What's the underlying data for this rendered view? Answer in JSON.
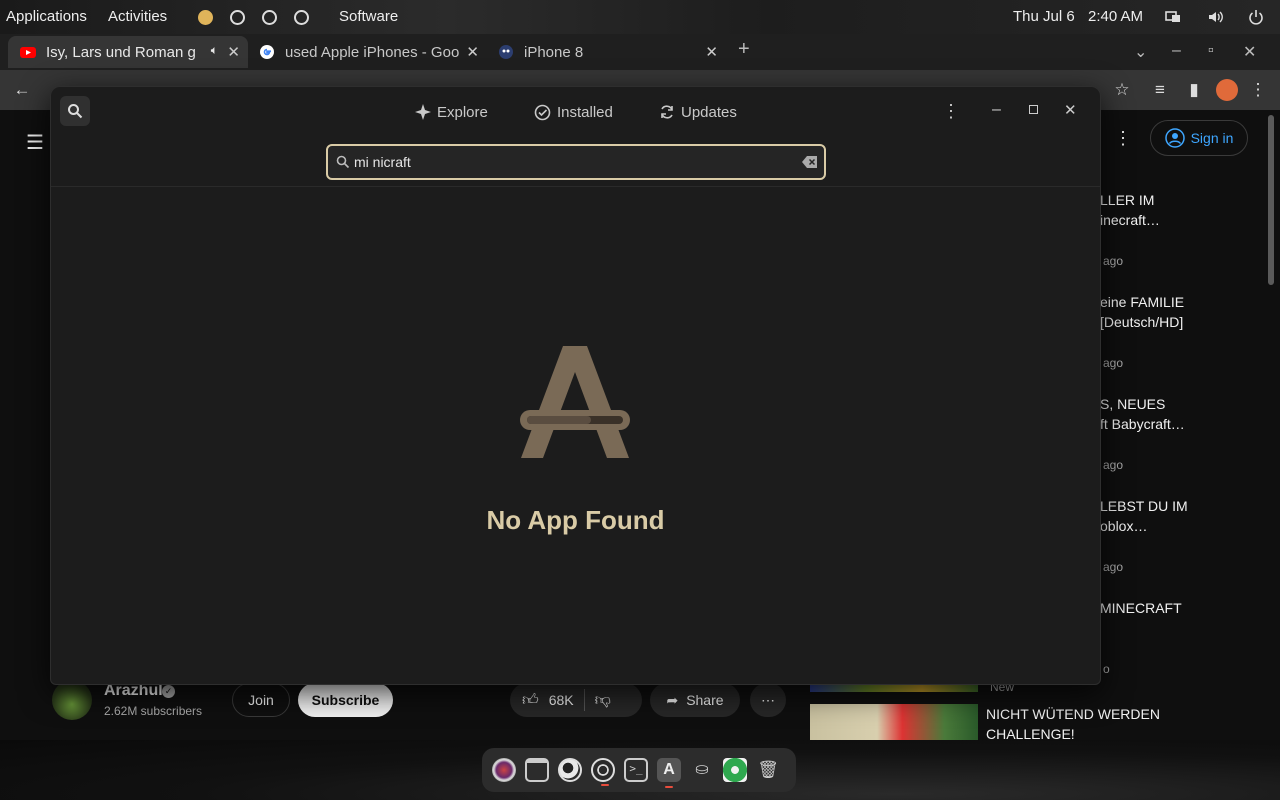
{
  "topbar": {
    "applications": "Applications",
    "activities": "Activities",
    "current_app": "Software",
    "date": "Thu Jul 6",
    "time": "2:40 AM"
  },
  "tabs": [
    {
      "title": "Isy, Lars und Roman g",
      "favicon": "youtube-icon",
      "audio": true
    },
    {
      "title": "used Apple iPhones - Goo",
      "favicon": "google-icon"
    },
    {
      "title": "iPhone 8",
      "favicon": "gsmarena-icon"
    }
  ],
  "youtube": {
    "sign_in": "Sign in",
    "channel_name": "Arazhul",
    "subscribers": "2.62M subscribers",
    "join": "Join",
    "subscribe": "Subscribe",
    "likes": "68K",
    "share": "Share",
    "recommendations": [
      {
        "title": "LLER IM\ninecraft…",
        "meta": "ago"
      },
      {
        "title": "eine FAMILIE\n[Deutsch/HD]",
        "meta": "ago"
      },
      {
        "title": "S, NEUES\nft Babycraft…",
        "meta": "ago"
      },
      {
        "title": "LEBST DU IM\noblox…",
        "meta": "ago"
      },
      {
        "title": "MINECRAFT",
        "meta": "o"
      },
      {
        "title": "NICHT WÜTEND WERDEN\nCHALLENGE!",
        "meta": "New"
      }
    ]
  },
  "app_center": {
    "tabs": [
      "Explore",
      "Installed",
      "Updates"
    ],
    "search_value": "mi nicraft",
    "empty_message": "No App Found"
  },
  "dock": [
    "lens-icon",
    "files-icon",
    "firefox-icon",
    "chrome-icon",
    "terminal-icon",
    "app-center-icon",
    "android-icon",
    "clover-icon",
    "trash-icon"
  ]
}
